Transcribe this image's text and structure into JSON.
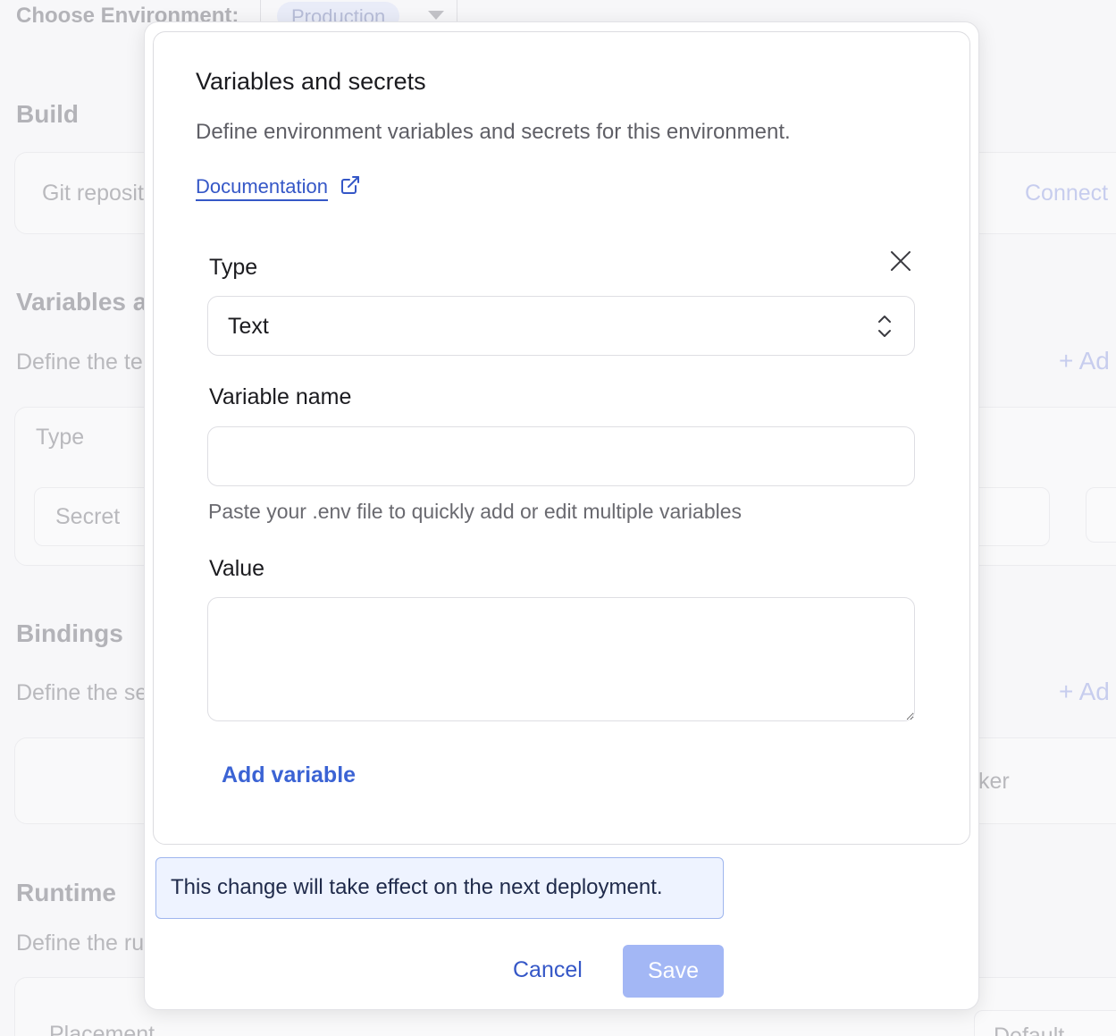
{
  "background": {
    "env_label": "Choose Environment:",
    "env_value": "Production",
    "build_heading": "Build",
    "git_label": "Git reposit",
    "connect_link": "Connect",
    "variables_heading": "Variables a",
    "variables_desc": "Define the te",
    "add_label_1": "Ad",
    "type_col": "Type",
    "secret_cell": "Secret",
    "bindings_heading": "Bindings",
    "bindings_desc": "Define the se",
    "add_label_2": "Ad",
    "worker_text": "ker",
    "runtime_heading": "Runtime",
    "runtime_desc": "Define the ru",
    "placement_label": "Placement",
    "default_label": "Default"
  },
  "modal": {
    "title": "Variables and secrets",
    "subtitle": "Define environment variables and secrets for this environment.",
    "doc_link": "Documentation",
    "type_label": "Type",
    "type_value": "Text",
    "variable_name_label": "Variable name",
    "variable_name_value": "",
    "hint": "Paste your .env file to quickly add or edit multiple variables",
    "value_label": "Value",
    "value_value": "",
    "add_variable": "Add variable",
    "notice": "This change will take effect on the next deployment.",
    "cancel": "Cancel",
    "save": "Save"
  },
  "colors": {
    "accent": "#3557c7",
    "save_disabled": "#a3b7f5",
    "notice_bg": "#eef3ff"
  },
  "icons": {
    "external_link": "external-link-icon",
    "close": "close-icon",
    "select_updown": "chevron-up-down-icon",
    "env_caret": "caret-down-icon"
  }
}
